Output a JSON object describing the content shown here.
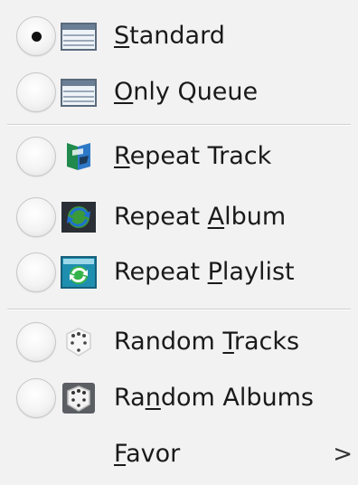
{
  "menu": {
    "items": [
      {
        "pre": "",
        "mn": "S",
        "post": "tandard",
        "checked": true,
        "icon": "standard-view-icon"
      },
      {
        "pre": "",
        "mn": "O",
        "post": "nly Queue",
        "checked": false,
        "icon": "queue-view-icon"
      },
      {
        "pre": "",
        "mn": "R",
        "post": "epeat Track",
        "checked": false,
        "icon": "repeat-track-icon"
      },
      {
        "pre": "Repeat ",
        "mn": "A",
        "post": "lbum",
        "checked": false,
        "icon": "repeat-album-icon"
      },
      {
        "pre": "Repeat ",
        "mn": "P",
        "post": "laylist",
        "checked": false,
        "icon": "repeat-playlist-icon"
      },
      {
        "pre": "Random ",
        "mn": "T",
        "post": "racks",
        "checked": false,
        "icon": "dice-white-icon"
      },
      {
        "pre": "Ra",
        "mn": "n",
        "post": "dom Albums",
        "checked": false,
        "icon": "dice-gray-icon"
      },
      {
        "pre": "",
        "mn": "F",
        "post": "avor",
        "submenu_arrow": ">"
      }
    ]
  }
}
